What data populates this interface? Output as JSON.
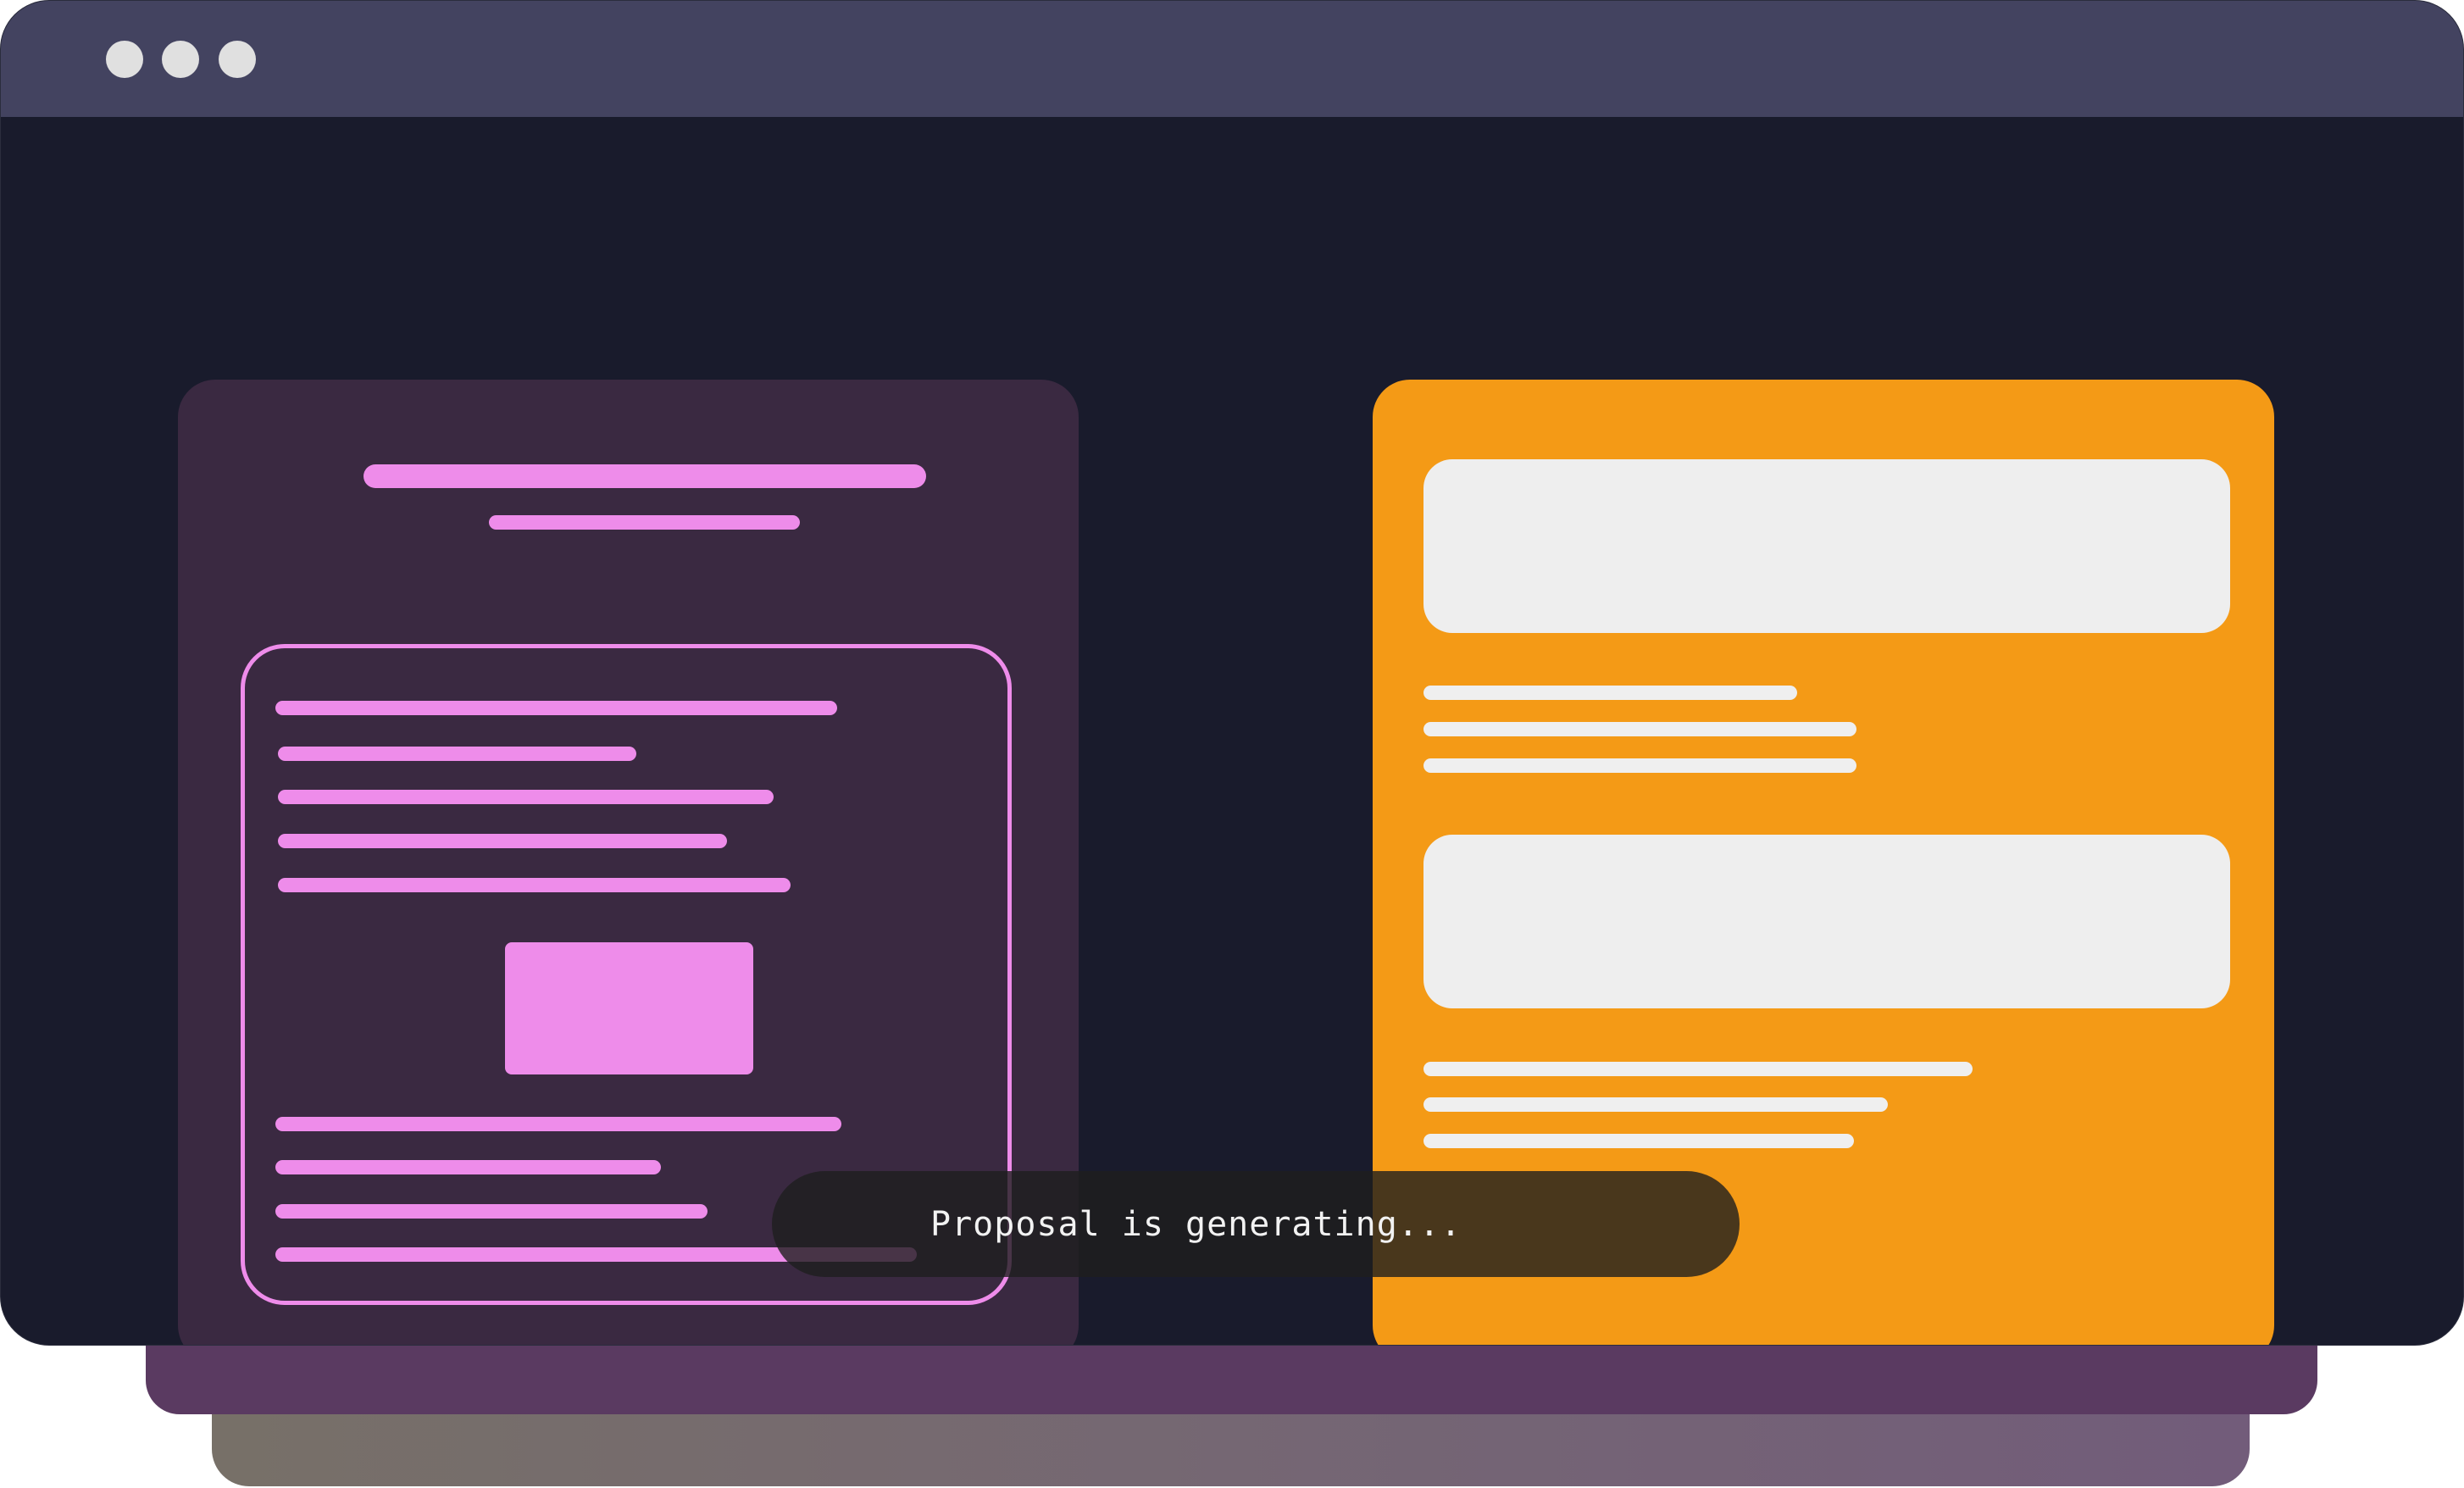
{
  "window": {
    "titlebar_buttons": [
      "window-dot",
      "window-dot",
      "window-dot"
    ]
  },
  "status": {
    "message": "Proposal is generating..."
  },
  "colors": {
    "window_bg": "#191b2c",
    "titlebar": "#434360",
    "doc_card": "#3a2941",
    "doc_accent": "#ee8cea",
    "orange_card": "#f49a16",
    "orange_blocks": "#eeeeee",
    "layer_mid": "#5a3a61",
    "status_pill": "#1e1e1e"
  }
}
